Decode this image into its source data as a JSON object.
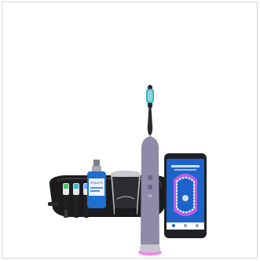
{
  "image": {
    "bottle_brand": "PHILIPS",
    "colors": {
      "background": "#ffffff",
      "frame_border": "#d6d6d6",
      "toothbrush_body": "#8e8aa8",
      "toothbrush_neck": "#2b2a33",
      "brush_head_bristles": "#3fb8c4",
      "charger_glow": "#f060d8",
      "case": "#1c1c1e",
      "bottle_blue": "#1f6fd0",
      "phone_body": "#202124",
      "phone_screen": "#1e63c9",
      "app_teeth": "#eef4ff",
      "app_gums": "#b560e8"
    },
    "icons": [
      "toothbrush",
      "charging-glass",
      "travel-case",
      "brush-heads",
      "mouthwash-bottle",
      "smartphone-app"
    ]
  }
}
